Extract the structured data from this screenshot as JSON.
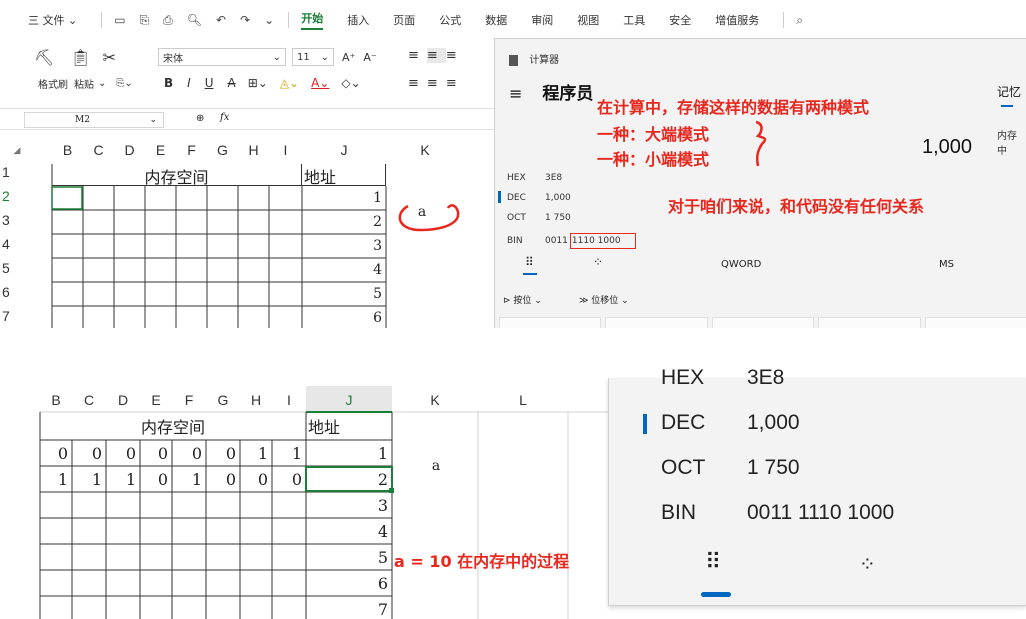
{
  "menubar": {
    "file": "三 文件 ⌄",
    "tabs": [
      "开始",
      "插入",
      "页面",
      "公式",
      "数据",
      "审阅",
      "视图",
      "工具",
      "安全",
      "增值服务"
    ]
  },
  "toolbar": {
    "format_painter": "格式刷",
    "paste": "粘贴",
    "font_name": "宋体",
    "font_size": "11",
    "bold": "B",
    "italic": "I",
    "underline": "U",
    "strike": "A"
  },
  "formula_bar": {
    "cell_ref": "M2",
    "fx": "fx"
  },
  "sheet_top": {
    "columns": [
      "B",
      "C",
      "D",
      "E",
      "F",
      "G",
      "H",
      "I",
      "J",
      "K"
    ],
    "rows": [
      "1",
      "2",
      "3",
      "4",
      "5",
      "6",
      "7"
    ],
    "header_memory": "内存空间",
    "header_address": "地址",
    "addresses": [
      "1",
      "2",
      "3",
      "4",
      "5",
      "6"
    ],
    "var_label": "a"
  },
  "calculator": {
    "title": "计算器",
    "mode": "程序员",
    "menu_icon": "≡",
    "display_value": "1,000",
    "memory_label": "记忆",
    "memory_text": "内存中",
    "radix": [
      {
        "label": "HEX",
        "value": "3E8"
      },
      {
        "label": "DEC",
        "value": "1,000"
      },
      {
        "label": "OCT",
        "value": "1 750"
      },
      {
        "label": "BIN",
        "value": "0011 1110 1000"
      }
    ],
    "bin_prefix": "0011",
    "bin_highlight": "1110 1000",
    "word_size": "QWORD",
    "ms": "MS",
    "bitwise": "按位",
    "bitshift": "位移位"
  },
  "annotations": {
    "line1": "在计算中，存储这样的数据有两种模式",
    "line2": "一种：大端模式",
    "line3": "一种：小端模式",
    "line4": "对于咱们来说，和代码没有任何关系",
    "bottom": "a = 10 在内存中的过程"
  },
  "sheet_bottom": {
    "columns": [
      "B",
      "C",
      "D",
      "E",
      "F",
      "G",
      "H",
      "I",
      "J",
      "K",
      "L"
    ],
    "header_memory": "内存空间",
    "header_address": "地址",
    "row1_bits": [
      "0",
      "0",
      "0",
      "0",
      "0",
      "0",
      "1",
      "1"
    ],
    "row2_bits": [
      "1",
      "1",
      "1",
      "0",
      "1",
      "0",
      "0",
      "0"
    ],
    "addresses": [
      "1",
      "2",
      "3",
      "4",
      "5",
      "6",
      "7"
    ],
    "var_label": "a"
  },
  "calculator_zoom": {
    "radix": [
      {
        "label": "HEX",
        "value": "3E8"
      },
      {
        "label": "DEC",
        "value": "1,000"
      },
      {
        "label": "OCT",
        "value": "1 750"
      },
      {
        "label": "BIN",
        "value": "0011 1110 1000"
      }
    ]
  },
  "colors": {
    "accent_green": "#1a7f37",
    "annotation_red": "#e8271e",
    "calc_blue": "#0067c0"
  }
}
